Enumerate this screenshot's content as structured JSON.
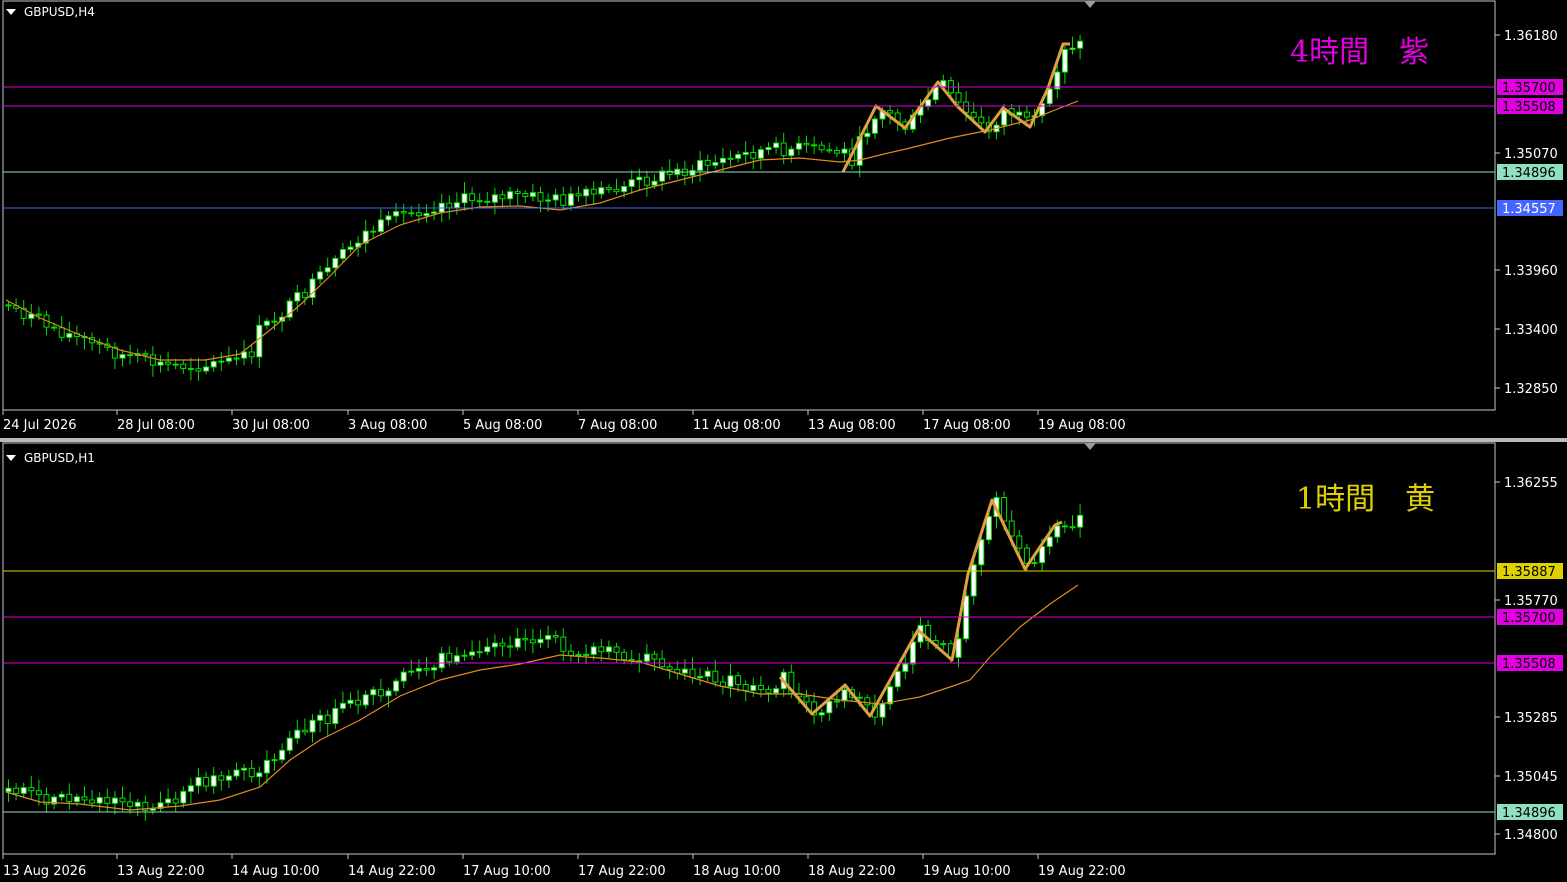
{
  "charts": [
    {
      "symbol_label": "GBPUSD,H4",
      "annotation": {
        "text": "4時間　紫",
        "color": "#e000e0"
      },
      "chart_data": {
        "type": "candlestick",
        "symbol": "GBPUSD",
        "timeframe": "H4",
        "ylim": [
          1.3263,
          1.3653
        ],
        "y_ticks": [
          "1.36180",
          "1.35070",
          "1.33960",
          "1.33400",
          "1.32850"
        ],
        "x_ticks": [
          "24 Jul 2026",
          "28 Jul 08:00",
          "30 Jul 08:00",
          "3 Aug 08:00",
          "5 Aug 08:00",
          "7 Aug 08:00",
          "11 Aug 08:00",
          "13 Aug 08:00",
          "17 Aug 08:00",
          "19 Aug 08:00"
        ],
        "price_levels": [
          {
            "label": "1.35700",
            "value": 1.357,
            "color": "#e000e0",
            "tag_text": "#000000"
          },
          {
            "label": "1.35508",
            "value": 1.35508,
            "color": "#e000e0",
            "tag_text": "#000000"
          },
          {
            "label": "1.34896",
            "value": 1.34896,
            "color": "#90e0c0",
            "tag_text": "#000000"
          },
          {
            "label": "1.34557",
            "value": 1.34557,
            "color": "#4466ff",
            "tag_text": "#ffffff"
          }
        ],
        "ma_color": "#e08a20",
        "zigzag_color": "#e0a040"
      }
    },
    {
      "symbol_label": "GBPUSD,H1",
      "annotation": {
        "text": "1時間　黄",
        "color": "#e0d000"
      },
      "chart_data": {
        "type": "candlestick",
        "symbol": "GBPUSD",
        "timeframe": "H1",
        "ylim": [
          1.3471,
          1.3637
        ],
        "y_ticks": [
          "1.36255",
          "1.35770",
          "1.35285",
          "1.35045",
          "1.34800"
        ],
        "x_ticks": [
          "13 Aug 2026",
          "13 Aug 22:00",
          "14 Aug 10:00",
          "14 Aug 22:00",
          "17 Aug 10:00",
          "17 Aug 22:00",
          "18 Aug 10:00",
          "18 Aug 22:00",
          "19 Aug 10:00",
          "19 Aug 22:00"
        ],
        "price_levels": [
          {
            "label": "1.35887",
            "value": 1.35887,
            "color": "#e0d000",
            "tag_text": "#000000"
          },
          {
            "label": "1.35700",
            "value": 1.357,
            "color": "#e000e0",
            "tag_text": "#000000"
          },
          {
            "label": "1.35508",
            "value": 1.35508,
            "color": "#e000e0",
            "tag_text": "#000000"
          },
          {
            "label": "1.34896",
            "value": 1.34896,
            "color": "#90e0c0",
            "tag_text": "#000000"
          }
        ],
        "ma_color": "#e08a20",
        "zigzag_color": "#e0a040"
      }
    }
  ]
}
